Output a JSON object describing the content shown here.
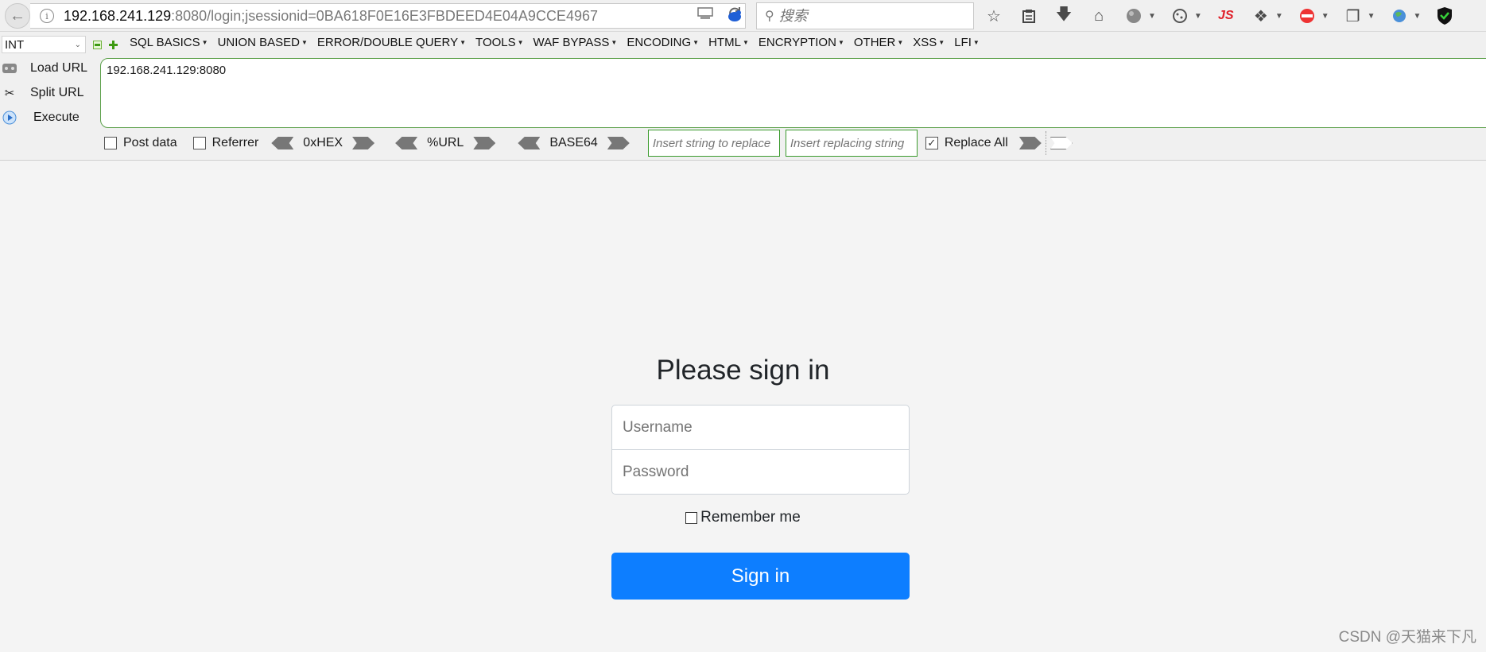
{
  "browser": {
    "url_host": "192.168.241.129",
    "url_rest": ":8080/login;jsessionid=0BA618F0E16E3FBDEED4E04A9CCE4967",
    "search_placeholder": "搜索",
    "js_label": "JS"
  },
  "hackbar": {
    "type_select": "INT",
    "menus": [
      "SQL BASICS",
      "UNION BASED",
      "ERROR/DOUBLE QUERY",
      "TOOLS",
      "WAF BYPASS",
      "ENCODING",
      "HTML",
      "ENCRYPTION",
      "OTHER",
      "XSS",
      "LFI"
    ],
    "load_url": "Load URL",
    "split_url": "Split URL",
    "execute": "Execute",
    "url_value": "192.168.241.129:8080",
    "post_data": "Post data",
    "referrer": "Referrer",
    "hex": "0xHEX",
    "url_enc": "%URL",
    "base64": "BASE64",
    "replace_placeholder": "Insert string to replace",
    "replacing_placeholder": "Insert replacing string",
    "replace_all": "Replace All",
    "replace_all_checked": true
  },
  "login": {
    "title": "Please sign in",
    "username_placeholder": "Username",
    "password_placeholder": "Password",
    "remember": "Remember me",
    "submit": "Sign in"
  },
  "watermark": "CSDN @天猫来下凡",
  "colors": {
    "primary": "#0d7eff",
    "hackbar_green": "#3a9a2c",
    "js_red": "#e0202a"
  }
}
